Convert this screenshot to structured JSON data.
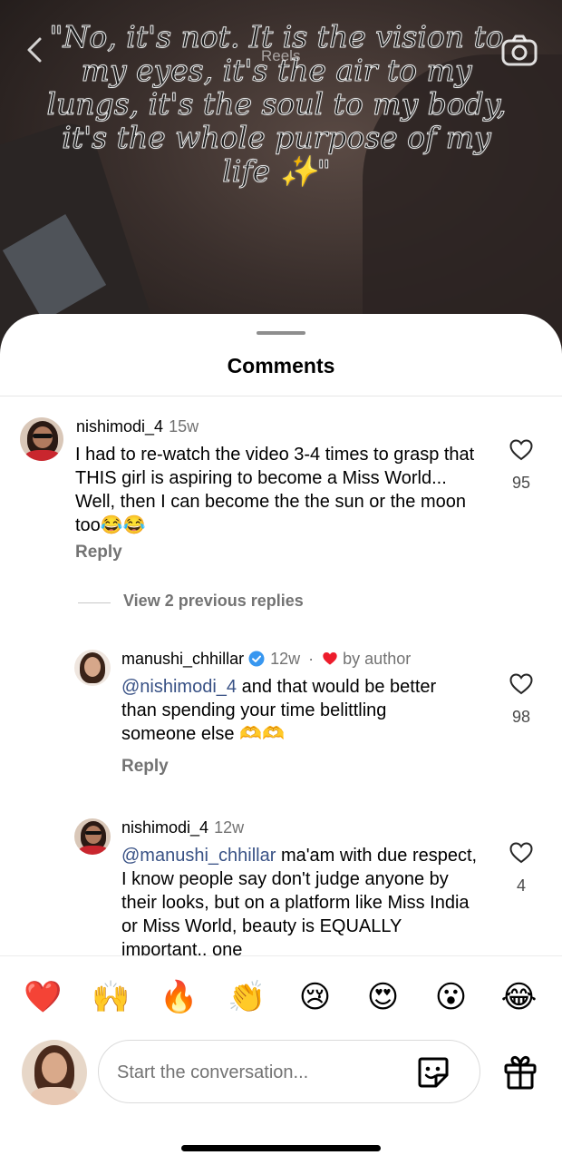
{
  "video": {
    "caption": "\"No, it's not. It is the vision to my eyes, it's the air to my lungs, it's the soul to my body, it's the whole purpose of my life ✨\"",
    "header_label": "Reels"
  },
  "sheet": {
    "title": "Comments"
  },
  "comments": [
    {
      "username": "nishimodi_4",
      "time": "15w",
      "text": "I had to re-watch the video 3-4 times to grasp that THIS girl is aspiring to become a Miss World... Well, then I can become the the sun or the moon too😂😂",
      "likes": "95",
      "reply_label": "Reply"
    }
  ],
  "view_replies_label": "View 2 previous replies",
  "replies": [
    {
      "username": "manushi_chhillar",
      "verified": true,
      "time": "12w",
      "separator": "·",
      "liked_by": "by author",
      "mention": "@nishimodi_4",
      "text": " and that would be better than spending your time belittling someone else 🫶🫶",
      "likes": "98",
      "reply_label": "Reply"
    },
    {
      "username": "nishimodi_4",
      "time": "12w",
      "mention": "@manushi_chhillar",
      "text": " ma'am with due respect, I know people say don't judge anyone by their looks, but on a platform like Miss India or Miss World, beauty is EQUALLY important.. one",
      "likes": "4"
    }
  ],
  "quick_reactions": [
    "❤️",
    "🙌",
    "🔥",
    "👏",
    "😢",
    "😍",
    "😮",
    "😂"
  ],
  "composer": {
    "placeholder": "Start the conversation..."
  },
  "colors": {
    "mention": "#385185",
    "secondary_text": "#737373",
    "verified": "#3897f0",
    "heart_red": "#ed1c2b"
  }
}
